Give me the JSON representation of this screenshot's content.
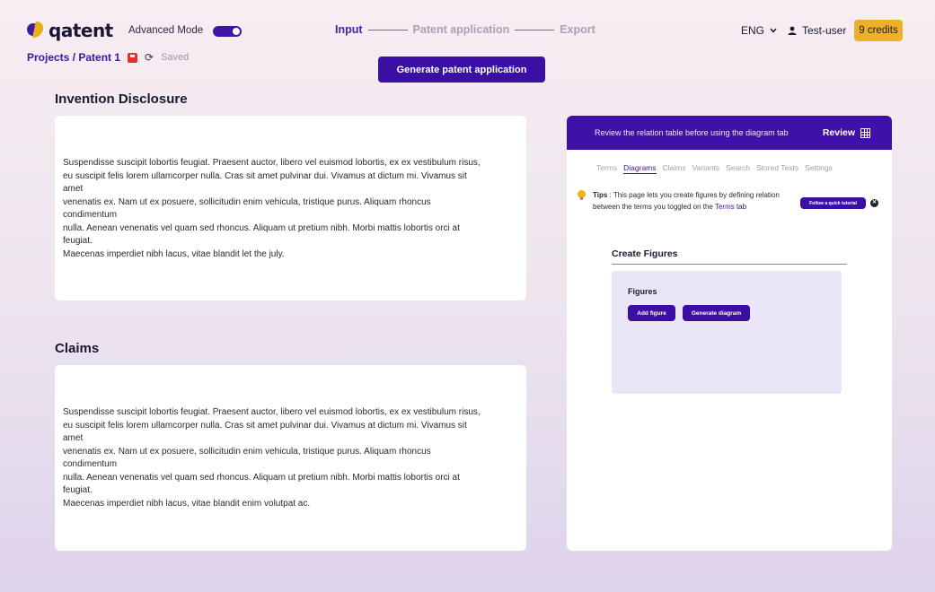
{
  "header": {
    "logo_text": "qatent",
    "advanced_mode_label": "Advanced Mode",
    "advanced_mode_on": true,
    "steps": [
      {
        "label": "Input",
        "active": true
      },
      {
        "label": "Patent application",
        "active": false
      },
      {
        "label": "Export",
        "active": false
      }
    ],
    "language": "ENG",
    "user_name": "Test-user",
    "credits": "9 credits"
  },
  "breadcrumb": {
    "path": "Projects / Patent 1",
    "status": "Saved"
  },
  "generate_button": "Generate patent application",
  "disclosure": {
    "title": "Invention Disclosure",
    "text": "Suspendisse suscipit lobortis feugiat. Praesent auctor, libero vel euismod lobortis, ex ex vestibulum risus,\neu suscipit felis lorem ullamcorper nulla. Cras sit amet pulvinar dui. Vivamus at dictum mi. Vivamus sit\namet\nvenenatis ex. Nam ut ex posuere, sollicitudin enim vehicula, tristique purus. Aliquam rhoncus\ncondimentum\nnulla. Aenean venenatis vel quam sed rhoncus. Aliquam ut pretium nibh. Morbi mattis lobortis orci at\nfeugiat.\nMaecenas imperdiet nibh lacus, vitae blandit let the july."
  },
  "claims": {
    "title": "Claims",
    "text": "Suspendisse suscipit lobortis feugiat. Praesent auctor, libero vel euismod lobortis, ex ex vestibulum risus,\neu suscipit felis lorem ullamcorper nulla. Cras sit amet pulvinar dui. Vivamus at dictum mi. Vivamus sit\namet\nvenenatis ex. Nam ut ex posuere, sollicitudin enim vehicula, tristique purus. Aliquam rhoncus\ncondimentum\nnulla. Aenean venenatis vel quam sed rhoncus. Aliquam ut pretium nibh. Morbi mattis lobortis orci at\nfeugiat.\nMaecenas imperdiet nibh lacus, vitae blandit enim volutpat ac."
  },
  "panel": {
    "banner_message": "Review the relation table before using the diagram tab",
    "review_label": "Review",
    "tabs": [
      "Terms",
      "Diagrams",
      "Claims",
      "Variants",
      "Search",
      "Stored Texts",
      "Settings"
    ],
    "active_tab": "Diagrams",
    "tips_label": "Tips",
    "tips_text": " : This page lets you create figures by defining relation between the terms you toggled on the ",
    "tips_link": "Terms",
    "tips_suffix": " tab",
    "tutorial_button": "Follow a quick tutorial",
    "create_figures_title": "Create Figures",
    "figures_label": "Figures",
    "add_figure_button": "Add figure",
    "generate_diagram_button": "Generate diagram"
  },
  "colors": {
    "accent": "#3b0fa3",
    "credits_bg": "#ecb12a"
  }
}
